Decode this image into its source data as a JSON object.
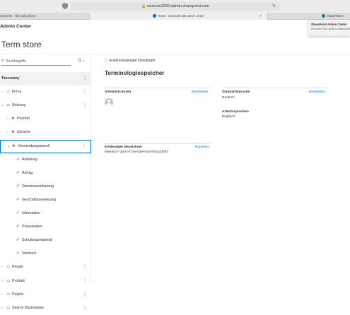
{
  "browser": {
    "url": "nexcore2000-admin.sharepoint.com",
    "tabs": [
      {
        "label": "ienzenter - Alle Dokumente"
      },
      {
        "label": "Home - Microsoft 365 admin center"
      },
      {
        "label": "SharePoint A"
      }
    ],
    "tab_close_glyph": "×",
    "icons": {
      "lock": "lock-icon",
      "reload": "reload-icon",
      "shield": "shield-icon"
    }
  },
  "app": {
    "title": "Admin Center"
  },
  "notification": {
    "title": "SharePoint Admin Center",
    "subtitle": "nexcore2000-admin.sharepoint.com"
  },
  "page": {
    "title": "Term store"
  },
  "left_pane": {
    "search_placeholder": "Suchbegriffe",
    "tree": [
      {
        "label": "Taxonomy",
        "level": 0,
        "chevron": "",
        "icon": "",
        "more": "⋮",
        "bold": true,
        "selected": true
      },
      {
        "label": "Firma",
        "level": 0,
        "chevron": "›",
        "icon": "folder-icon",
        "more": "⋮"
      },
      {
        "label": "Nutzung",
        "level": 0,
        "chevron": "⌄",
        "icon": "folder-icon",
        "more": "⋮"
      },
      {
        "label": "Priorität",
        "level": 1,
        "chevron": "›",
        "icon": "termset-icon",
        "more": ""
      },
      {
        "label": "Sprache",
        "level": 1,
        "chevron": "›",
        "icon": "termset-icon",
        "more": ""
      },
      {
        "label": "Verwendungszweck",
        "level": 1,
        "chevron": "⌄",
        "icon": "termset-icon",
        "more": "⋮",
        "boxed": true
      },
      {
        "label": "Anleitung",
        "level": 2,
        "chevron": "",
        "icon": "tag-icon",
        "more": ""
      },
      {
        "label": "Antrag",
        "level": 2,
        "chevron": "",
        "icon": "tag-icon",
        "more": ""
      },
      {
        "label": "Dienstvereinbarung",
        "level": 2,
        "chevron": "",
        "icon": "tag-icon",
        "more": ""
      },
      {
        "label": "Geschäftsanweisung",
        "level": 2,
        "chevron": "",
        "icon": "tag-icon",
        "more": ""
      },
      {
        "label": "Information",
        "level": 2,
        "chevron": "",
        "icon": "tag-icon",
        "more": ""
      },
      {
        "label": "Präsentation",
        "level": 2,
        "chevron": "",
        "icon": "tag-icon",
        "more": ""
      },
      {
        "label": "Schulungsmaterial",
        "level": 2,
        "chevron": "",
        "icon": "tag-icon",
        "more": ""
      },
      {
        "label": "Vordruck",
        "level": 2,
        "chevron": "",
        "icon": "tag-icon",
        "more": ""
      },
      {
        "label": "People",
        "level": 0,
        "chevron": "›",
        "icon": "folder-icon",
        "more": "⋮"
      },
      {
        "label": "Produkt",
        "level": 0,
        "chevron": "›",
        "icon": "folder-icon",
        "more": "⋮"
      },
      {
        "label": "Projekt",
        "level": 0,
        "chevron": "›",
        "icon": "folder-icon",
        "more": "⋮"
      },
      {
        "label": "Search Dictionaries",
        "level": 0,
        "chevron": "›",
        "icon": "folder-icon",
        "more": "⋮"
      }
    ]
  },
  "main": {
    "add_group_label": "Ausdrucksgruppe hinzufügen",
    "title": "Terminologiespeicher",
    "admins": {
      "label": "Administratoren",
      "edit": "Bearbeiten"
    },
    "default_language": {
      "label": "Standardsprache",
      "value": "Deutsch",
      "edit": "Bearbeiten"
    },
    "working_languages": {
      "label": "Arbeitssprachen",
      "value": "Englisch"
    },
    "unique_id": {
      "label": "Eindeutiger Bezeichner",
      "value": "8faea017-2a03-474e-b3e8-b2e40ca2d487",
      "copy": "Kopieren"
    }
  },
  "colors": {
    "accent": "#0078d4",
    "selected_bg": "#f3f2f1"
  }
}
